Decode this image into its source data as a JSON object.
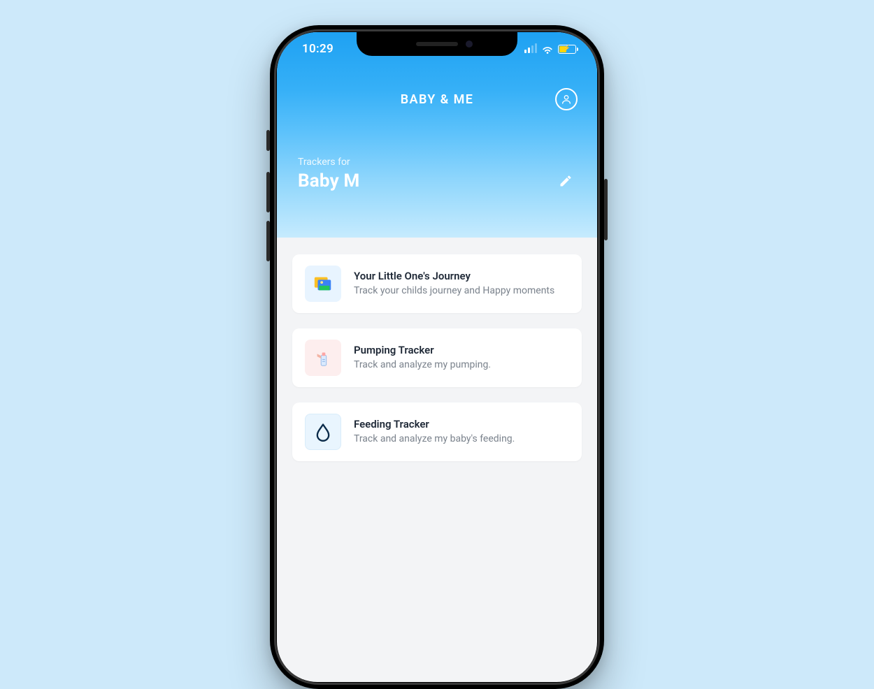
{
  "statusBar": {
    "time": "10:29"
  },
  "header": {
    "appTitle": "BABY & ME",
    "subLabel": "Trackers for",
    "babyName": "Baby M"
  },
  "cards": [
    {
      "title": "Your Little One's Journey",
      "desc": "Track your childs journey and Happy moments"
    },
    {
      "title": "Pumping Tracker",
      "desc": "Track and analyze my pumping."
    },
    {
      "title": "Feeding Tracker",
      "desc": "Track and analyze my baby's feeding."
    }
  ]
}
